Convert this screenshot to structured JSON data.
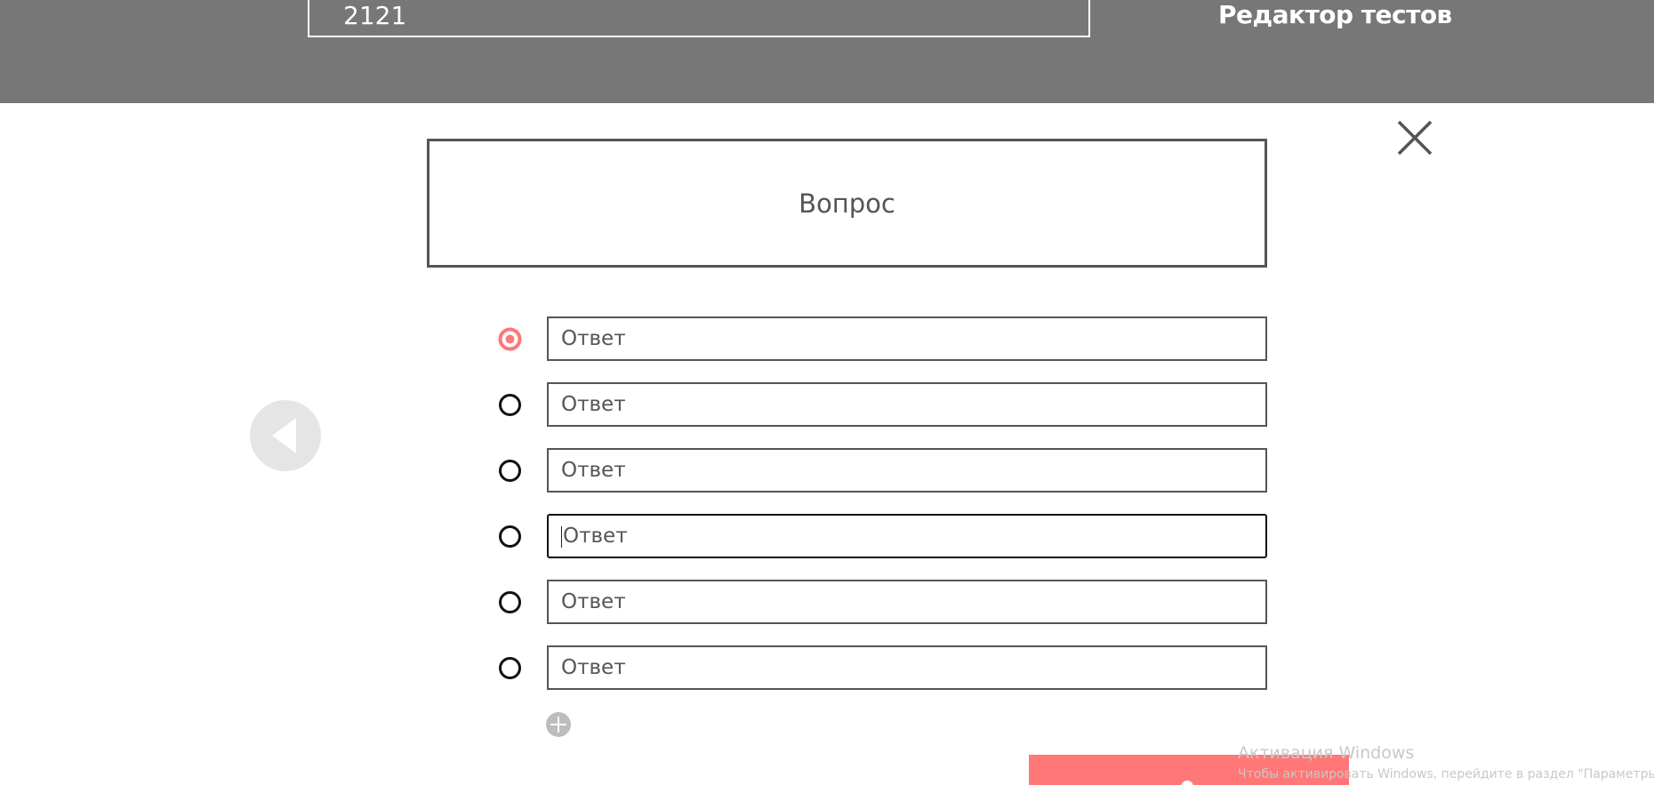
{
  "header": {
    "test_name": "2121",
    "title": "Редактор тестов"
  },
  "question": {
    "placeholder": "Вопрос"
  },
  "answers": [
    {
      "placeholder": "Ответ",
      "selected": true
    },
    {
      "placeholder": "Ответ",
      "selected": false
    },
    {
      "placeholder": "Ответ",
      "selected": false
    },
    {
      "placeholder": "Ответ",
      "selected": false,
      "focused": true
    },
    {
      "placeholder": "Ответ",
      "selected": false
    },
    {
      "placeholder": "Ответ",
      "selected": false
    }
  ],
  "icons": {
    "close": "close-icon",
    "previous": "arrow-left-icon",
    "add": "plus-icon",
    "save": "save-icon"
  },
  "colors": {
    "header_bg": "#777777",
    "accent": "#ff7777",
    "border": "#555555",
    "prev_button_bg": "#e5e5e5"
  },
  "watermark": {
    "title": "Активация Windows",
    "subtitle": "Чтобы активировать Windows, перейдите в раздел \"Параметры\"."
  }
}
